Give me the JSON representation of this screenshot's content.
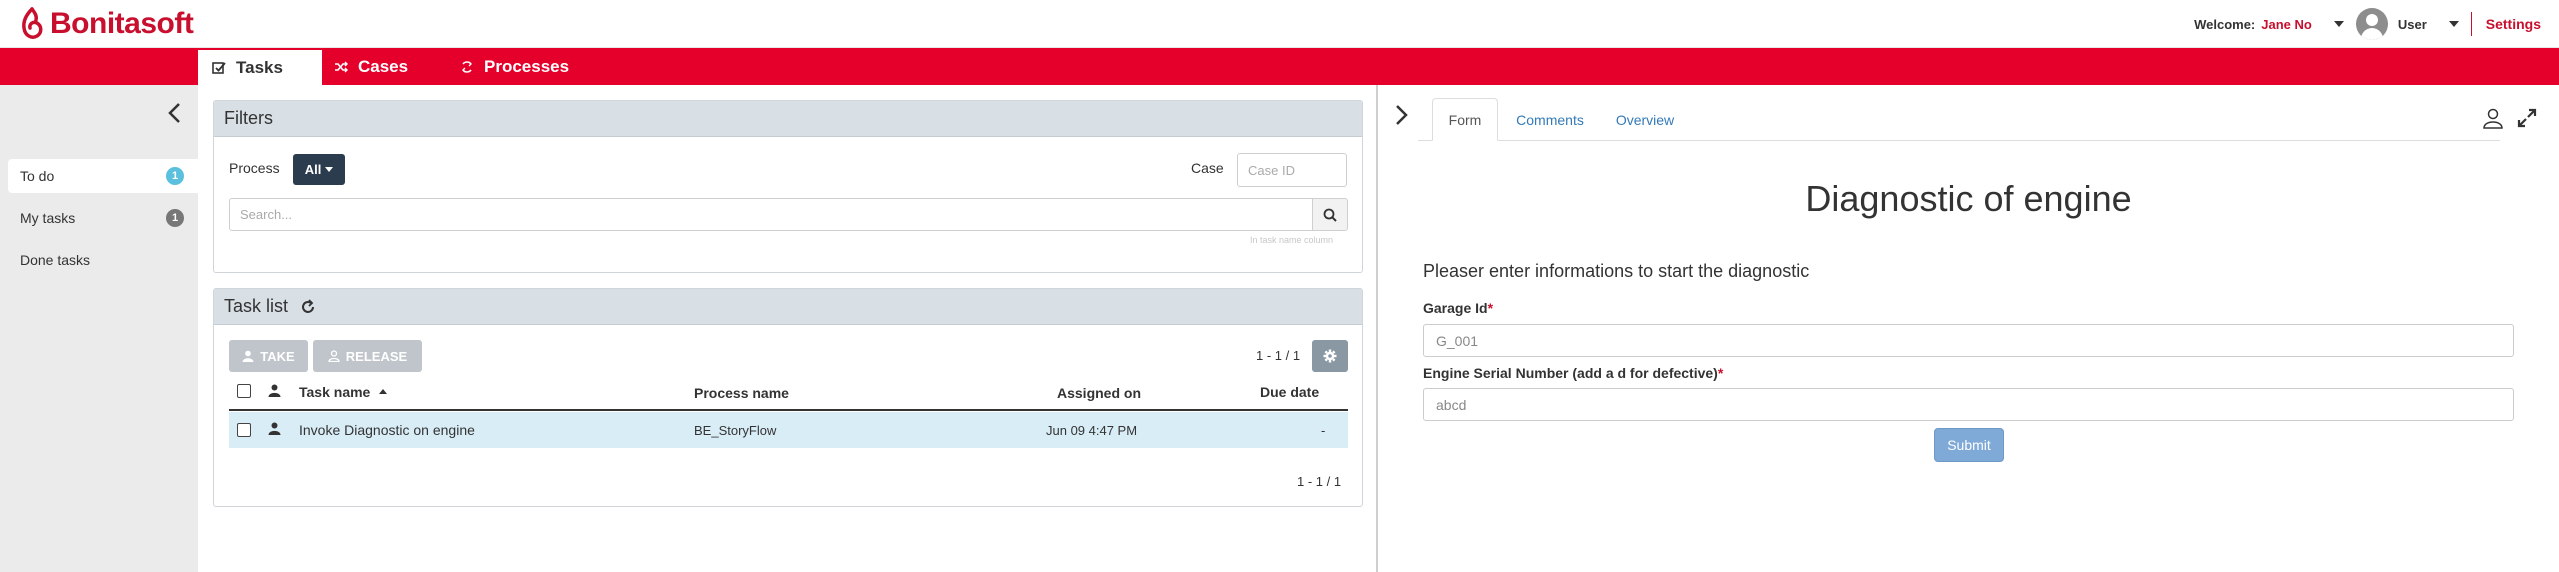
{
  "header": {
    "logo_text": "Bonitasoft",
    "welcome_label": "Welcome:",
    "user_name": "Jane No",
    "user_role": "User",
    "settings_label": "Settings"
  },
  "nav": {
    "tabs": [
      {
        "label": "Tasks",
        "icon": "check-square-icon",
        "active": true
      },
      {
        "label": "Cases",
        "icon": "shuffle-icon",
        "active": false
      },
      {
        "label": "Processes",
        "icon": "cycle-icon",
        "active": false
      }
    ]
  },
  "sidebar": {
    "items": [
      {
        "label": "To do",
        "count": "1",
        "badge_color": "#5bc0de",
        "active": true
      },
      {
        "label": "My tasks",
        "count": "1",
        "badge_color": "#777777",
        "active": false
      },
      {
        "label": "Done tasks",
        "count": "",
        "active": false
      }
    ]
  },
  "filters": {
    "title": "Filters",
    "process_label": "Process",
    "process_value": "All",
    "case_label": "Case",
    "case_placeholder": "Case ID",
    "search_placeholder": "Search...",
    "search_hint": "In task name column"
  },
  "tasklist": {
    "title": "Task list",
    "take_label": "TAKE",
    "release_label": "RELEASE",
    "pager_top": "1 - 1 / 1",
    "pager_bottom": "1 - 1 / 1",
    "columns": {
      "task_name": "Task name",
      "process_name": "Process name",
      "assigned_on": "Assigned on",
      "due_date": "Due date"
    },
    "rows": [
      {
        "task_name": "Invoke Diagnostic on engine",
        "process_name": "BE_StoryFlow",
        "assigned_on": "Jun 09 4:47 PM",
        "due_date": "-"
      }
    ]
  },
  "detail": {
    "tabs": [
      {
        "label": "Form",
        "active": true
      },
      {
        "label": "Comments",
        "active": false
      },
      {
        "label": "Overview",
        "active": false
      }
    ],
    "form": {
      "title": "Diagnostic of engine",
      "subtitle": "Pleaser enter informations to start the diagnostic",
      "fields": [
        {
          "label": "Garage Id",
          "required_mark": "*",
          "value": "G_001"
        },
        {
          "label": "Engine Serial Number (add a d for defective)",
          "required_mark": "*",
          "value": "abcd"
        }
      ],
      "submit_label": "Submit"
    }
  },
  "colors": {
    "brand_red": "#e4002b",
    "panel_header": "#d8dfe5",
    "dark_button": "#2b3c4f",
    "selected_row": "#d9edf7",
    "link_blue": "#337ab7"
  }
}
